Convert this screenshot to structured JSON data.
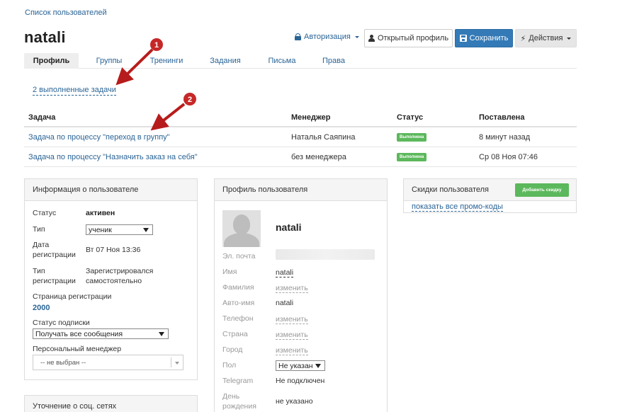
{
  "breadcrumb": "Список пользователей",
  "user_title": "natali",
  "header": {
    "auth_label": "Авторизация",
    "open_profile_label": "Открытый профиль",
    "save_label": "Сохранить",
    "actions_label": "Действия"
  },
  "tabs": [
    {
      "label": "Профиль",
      "active": true
    },
    {
      "label": "Группы",
      "active": false
    },
    {
      "label": "Тренинги",
      "active": false
    },
    {
      "label": "Задания",
      "active": false
    },
    {
      "label": "Письма",
      "active": false
    },
    {
      "label": "Права",
      "active": false
    }
  ],
  "completed_tasks_link": "2 выполненные задачи",
  "tasks_table": {
    "headers": [
      "Задача",
      "Менеджер",
      "Статус",
      "Поставлена"
    ],
    "rows": [
      {
        "task": "Задача по процессу \"переход в группу\"",
        "manager": "Наталья Саяпина",
        "status": "Выполнена",
        "created": "8 минут назад"
      },
      {
        "task": "Задача по процессу \"Назначить заказ на себя\"",
        "manager": "без менеджера",
        "status": "Выполнена",
        "created": "Ср 08 Ноя 07:46"
      }
    ]
  },
  "annotations": [
    "1",
    "2"
  ],
  "user_info": {
    "title": "Информация о пользователе",
    "status_label": "Статус",
    "status_value": "активен",
    "type_label": "Тип",
    "type_value": "ученик",
    "reg_date_label_1": "Дата",
    "reg_date_label_2": "регистрации",
    "reg_date_value": "Вт 07 Ноя 13:36",
    "reg_type_label_1": "Тип",
    "reg_type_label_2": "регистрации",
    "reg_type_value_1": "Зарегистрировался",
    "reg_type_value_2": "самостоятельно",
    "reg_page_label": "Страница регистрации",
    "reg_page_value": "2000",
    "subscription_label": "Статус подписки",
    "subscription_value": "Получать все сообщения",
    "manager_label": "Персональный менеджер",
    "manager_value": "-- не выбран --"
  },
  "social": {
    "title": "Уточнение о соц. сетях"
  },
  "profile": {
    "title": "Профиль пользователя",
    "name": "natali",
    "fields": {
      "email_label": "Эл. почта",
      "first_name_label": "Имя",
      "first_name_value": "natali",
      "last_name_label": "Фамилия",
      "last_name_value": "изменить",
      "auto_name_label": "Авто-имя",
      "auto_name_value": "natali",
      "phone_label": "Телефон",
      "phone_value": "изменить",
      "country_label": "Страна",
      "country_value": "изменить",
      "city_label": "Город",
      "city_value": "изменить",
      "gender_label": "Пол",
      "gender_value": "Не указан",
      "telegram_label": "Telegram",
      "telegram_value": "Не подключен",
      "birthday_label_1": "День",
      "birthday_label_2": "рождения",
      "birthday_value": "не указано"
    }
  },
  "discounts": {
    "title": "Скидки пользователя",
    "add_button": "Добавить скидку",
    "promo_link": "показать все промо-коды"
  },
  "colors": {
    "link": "#2a6496",
    "primary": "#337ab7",
    "success": "#5cb85c",
    "arrow": "#b71c1c"
  }
}
